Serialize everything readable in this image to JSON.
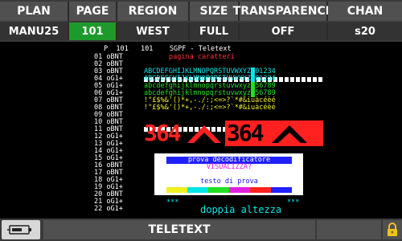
{
  "header": {
    "labels": [
      "PLAN",
      "PAGE",
      "REGION",
      "SIZE",
      "TRANSPARENCE",
      "CHAN"
    ],
    "values": [
      "MANU25",
      "101",
      "WEST",
      "FULL",
      "OFF",
      "s20"
    ],
    "selected_value_index": 1,
    "selected_color": "#1e9a2c"
  },
  "teletext": {
    "header_line": "P  101   101    SGPF - Teletext",
    "row_numbers": [
      "01",
      "02",
      "03",
      "04",
      "05",
      "06",
      "07",
      "08",
      "09",
      "10",
      "11",
      "12",
      "13",
      "14",
      "15",
      "16",
      "17",
      "18",
      "19",
      "20",
      "21",
      "22"
    ],
    "row_codes": [
      "oBNT",
      "oBNT",
      "oBNT",
      "oG1+",
      "oG1+",
      "oG1+",
      "oBNT",
      "oBNT",
      "oBNT",
      "oBNT",
      "oBNT",
      "oG1+",
      "oG1+",
      "oG1+",
      "oG1+",
      "oBNT",
      "oBNT",
      "oG1+",
      "oG1+",
      "oBNT",
      "oG1+",
      "oG1+"
    ],
    "row1_text": "pagina caratteri",
    "alpha_upper": "ABCDEFGHIJKLMNOPQRSTUVWXYZ",
    "digits_1": "01234",
    "alpha_lower": "abcdefghijklmnopqrstuvwxyz",
    "digits_2": "56789",
    "symbols": "!\"£$%&'()*+,-./:;<=>?`*#&iuàcéèé",
    "big_text": "364",
    "box_line1": "prova decodificatore",
    "box_line2": "VISUALIZZA?",
    "box_line3": "testo di prova",
    "stars": "***",
    "double_height": "doppia altezza",
    "colors": {
      "red": "#ff2020",
      "cyan": "#00e5e5",
      "blue": "#2020ff",
      "green": "#20e020",
      "yellow": "#f0f020",
      "magenta": "#e020e0"
    }
  },
  "footer": {
    "title": "TELETEXT",
    "battery_icon": "battery-charging-icon",
    "lock_icon": "lock-icon"
  }
}
